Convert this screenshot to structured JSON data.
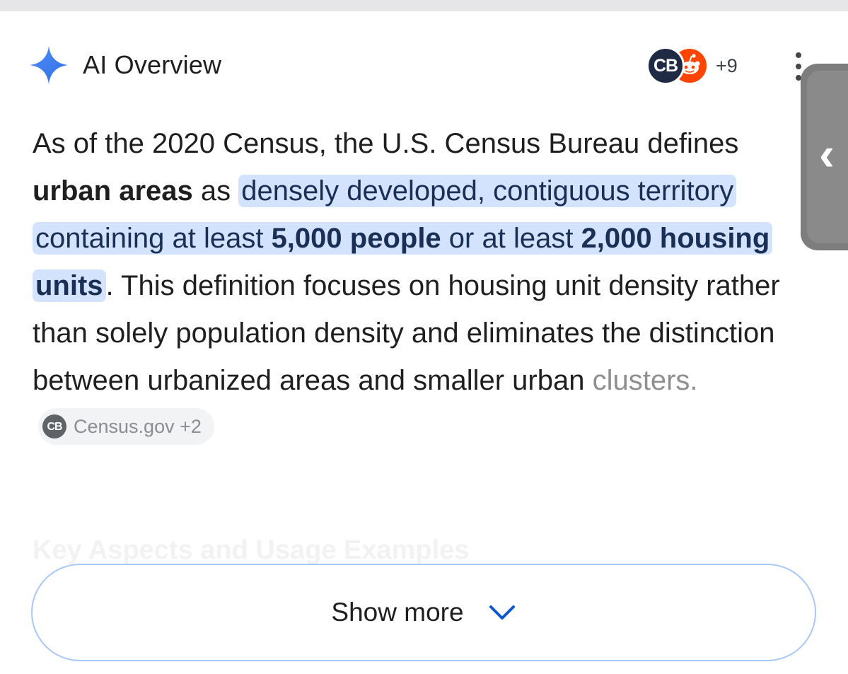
{
  "header": {
    "title": "AI Overview",
    "spark_icon": "sparkle-icon",
    "spark_color": "#4285f4"
  },
  "sources": {
    "avatars": [
      {
        "label": "CB",
        "icon": "census-bureau-logo",
        "color": "#1f2b45"
      },
      {
        "label": "",
        "icon": "reddit-icon",
        "color": "#ff4500"
      }
    ],
    "more_count": "+9"
  },
  "menu": {
    "icon": "more-vert-icon"
  },
  "side_handle": {
    "icon": "chevron-left-icon"
  },
  "overview": {
    "p1": "As of the 2020 Census, the U.S. Census Bureau defines ",
    "p2_bold": "urban areas",
    "p3": " as ",
    "hl1": "densely developed, contiguous territory containing at least ",
    "hl1_bold": "5,000 people",
    "hl2": " or at least ",
    "hl2_bold": "2,000 housing units",
    "p4": ". This definition focuses on housing unit density rather than solely population density and eliminates the distinction between urbanized areas and smaller urban ",
    "p4_fade": "clusters.",
    "chip": {
      "logo": "CB",
      "label": "Census.gov +2"
    }
  },
  "faded_heading": "Key Aspects and Usage Examples",
  "show_more": {
    "label": "Show more",
    "icon": "chevron-down-icon",
    "accent": "#0b57d0"
  }
}
